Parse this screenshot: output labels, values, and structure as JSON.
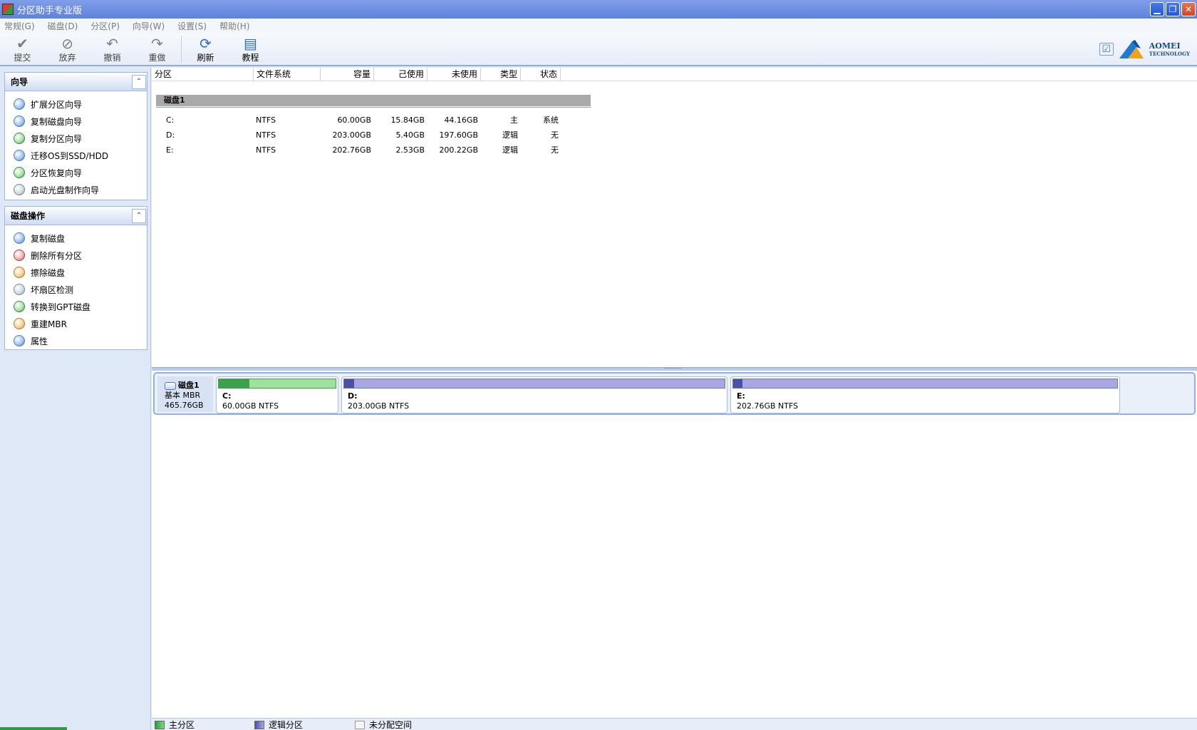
{
  "window": {
    "title": "分区助手专业版",
    "minimize_glyph": "▁",
    "restore_glyph": "❐",
    "close_glyph": "✕"
  },
  "menu": [
    "常规(G)",
    "磁盘(D)",
    "分区(P)",
    "向导(W)",
    "设置(S)",
    "帮助(H)"
  ],
  "toolbar": {
    "buttons": [
      {
        "label": "提交",
        "icon": "check-icon",
        "glyph": "✔"
      },
      {
        "label": "放弃",
        "icon": "discard-icon",
        "glyph": "⊘"
      },
      {
        "label": "撤销",
        "icon": "undo-icon",
        "glyph": "↶"
      },
      {
        "label": "重做",
        "icon": "redo-icon",
        "glyph": "↷"
      },
      {
        "label": "刷新",
        "icon": "refresh-icon",
        "glyph": "⟳"
      },
      {
        "label": "教程",
        "icon": "tutorial-icon",
        "glyph": "▤"
      }
    ],
    "brand_check": "☑",
    "brand_line1": "AOMEI",
    "brand_line2": "TECHNOLOGY"
  },
  "colors": {
    "primary": "#3aa24a",
    "logical": "#4a52a7",
    "unallocated": "#f5f5f5",
    "title_bar": "#6f8fe2"
  },
  "wizard_panel": {
    "title": "向导",
    "collapse_glyph": "⌃",
    "items": [
      {
        "label": "扩展分区向导",
        "icon": "extend-partition-icon"
      },
      {
        "label": "复制磁盘向导",
        "icon": "copy-disk-icon"
      },
      {
        "label": "复制分区向导",
        "icon": "copy-partition-icon"
      },
      {
        "label": "迁移OS到SSD/HDD",
        "icon": "migrate-os-icon"
      },
      {
        "label": "分区恢复向导",
        "icon": "partition-recovery-icon"
      },
      {
        "label": "启动光盘制作向导",
        "icon": "bootable-cd-icon"
      }
    ]
  },
  "disk_panel": {
    "title": "磁盘操作",
    "collapse_glyph": "⌃",
    "items": [
      {
        "label": "复制磁盘",
        "icon": "copy-disk-icon"
      },
      {
        "label": "删除所有分区",
        "icon": "delete-partitions-icon"
      },
      {
        "label": "擦除磁盘",
        "icon": "wipe-disk-icon"
      },
      {
        "label": "坏扇区检测",
        "icon": "bad-sector-icon"
      },
      {
        "label": "转换到GPT磁盘",
        "icon": "convert-gpt-icon"
      },
      {
        "label": "重建MBR",
        "icon": "rebuild-mbr-icon"
      },
      {
        "label": "属性",
        "icon": "properties-icon"
      }
    ]
  },
  "table": {
    "headers": [
      "分区",
      "文件系统",
      "容量",
      "己使用",
      "未使用",
      "类型",
      "状态"
    ],
    "disk_label": "磁盘1",
    "rows": [
      {
        "partition": "C:",
        "fs": "NTFS",
        "capacity": "60.00GB",
        "used": "15.84GB",
        "unused": "44.16GB",
        "type": "主",
        "status": "系统"
      },
      {
        "partition": "D:",
        "fs": "NTFS",
        "capacity": "203.00GB",
        "used": "5.40GB",
        "unused": "197.60GB",
        "type": "逻辑",
        "status": "无"
      },
      {
        "partition": "E:",
        "fs": "NTFS",
        "capacity": "202.76GB",
        "used": "2.53GB",
        "unused": "200.22GB",
        "type": "逻辑",
        "status": "无"
      }
    ]
  },
  "disk_map": {
    "name": "磁盘1",
    "type": "基本 MBR",
    "size": "465.76GB",
    "partitions": [
      {
        "letter": "C:",
        "info": "60.00GB NTFS",
        "used_fraction": 0.264,
        "kind": "primary"
      },
      {
        "letter": "D:",
        "info": "203.00GB NTFS",
        "used_fraction": 0.027,
        "kind": "logical"
      },
      {
        "letter": "E:",
        "info": "202.76GB NTFS",
        "used_fraction": 0.012,
        "kind": "logical"
      }
    ]
  },
  "legend": [
    "主分区",
    "逻辑分区",
    "未分配空间"
  ]
}
